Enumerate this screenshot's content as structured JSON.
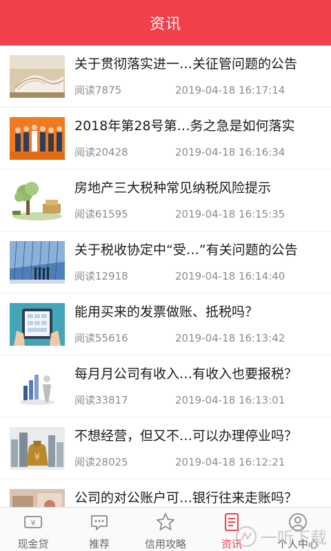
{
  "header": {
    "title": "资讯"
  },
  "articles": [
    {
      "title": "关于贯彻落实进一…关征管问题的公告",
      "reads": "阅读7875",
      "time": "2019-04-18 16:17:14",
      "thumb": "book-photo"
    },
    {
      "title": "2018年第28号第…务之急是如何落实",
      "reads": "阅读20428",
      "time": "2019-04-18 16:16:34",
      "thumb": "business-people-illustration"
    },
    {
      "title": "房地产三大税种常见纳税风险提示",
      "reads": "阅读61595",
      "time": "2019-04-18 16:15:35",
      "thumb": "money-tree-illustration"
    },
    {
      "title": "关于税收协定中“受…”有关问题的公告",
      "reads": "阅读12918",
      "time": "2019-04-18 16:14:40",
      "thumb": "office-building-photo"
    },
    {
      "title": "能用买来的发票做账、抵税吗？",
      "reads": "阅读55616",
      "time": "2019-04-18 16:13:42",
      "thumb": "tablet-hands-illustration"
    },
    {
      "title": "每月月公司有收入…有收入也要报税？",
      "reads": "阅读33817",
      "time": "2019-04-18 16:13:01",
      "thumb": "figure-chart-illustration"
    },
    {
      "title": "不想经营，但又不…可以办理停业吗？",
      "reads": "阅读28025",
      "time": "2019-04-18 16:12:21",
      "thumb": "money-bag-city-photo"
    },
    {
      "title": "公司的对公账户可…银行往来走账吗？",
      "reads": "",
      "time": "",
      "thumb": "bank-photo"
    }
  ],
  "tabs": [
    {
      "label": "现金贷",
      "icon": "ticket-icon"
    },
    {
      "label": "推荐",
      "icon": "chat-bubble-icon"
    },
    {
      "label": "信用攻略",
      "icon": "star-icon"
    },
    {
      "label": "资讯",
      "icon": "document-icon",
      "active": true
    },
    {
      "label": "个人中心",
      "icon": "user-icon"
    }
  ],
  "watermark": {
    "text": "一听下载"
  },
  "colors": {
    "accent": "#f2404a",
    "tab_inactive": "#666666",
    "meta": "#8c8c8c"
  }
}
